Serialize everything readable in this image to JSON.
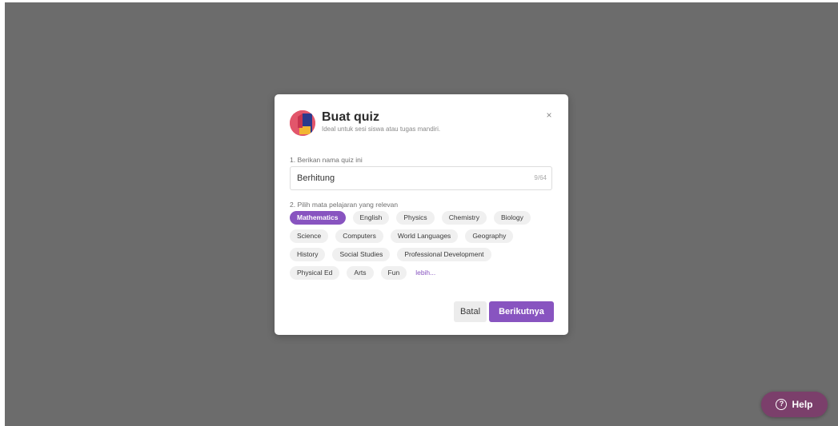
{
  "modal": {
    "title": "Buat quiz",
    "subtitle": "Ideal untuk sesi siswa atau tugas mandiri.",
    "close_icon": "×",
    "step1_label": "1. Berikan nama quiz ini",
    "name_value": "Berhitung",
    "char_count": "9/64",
    "step2_label": "2. Pilih mata pelajaran yang relevan",
    "subject_rows": [
      [
        "Mathematics",
        "English",
        "Physics",
        "Chemistry",
        "Biology"
      ],
      [
        "Science",
        "Computers",
        "World Languages",
        "Geography"
      ],
      [
        "History",
        "Social Studies",
        "Professional Development"
      ],
      [
        "Physical Ed",
        "Arts",
        "Fun"
      ]
    ],
    "selected_subject": "Mathematics",
    "more_label": "lebih...",
    "cancel_label": "Batal",
    "next_label": "Berikutnya"
  },
  "help": {
    "icon": "?",
    "label": "Help"
  },
  "colors": {
    "accent": "#8854c0",
    "overlay": "#6c6c6c",
    "help_button": "#7b3f6b",
    "logo_red": "#e2566b",
    "logo_blue": "#2b3a8c",
    "logo_yellow": "#f2b632"
  },
  "icons": {
    "logo": "quiz-app-logo-icon",
    "close": "close-icon",
    "help": "question-circle-icon"
  }
}
